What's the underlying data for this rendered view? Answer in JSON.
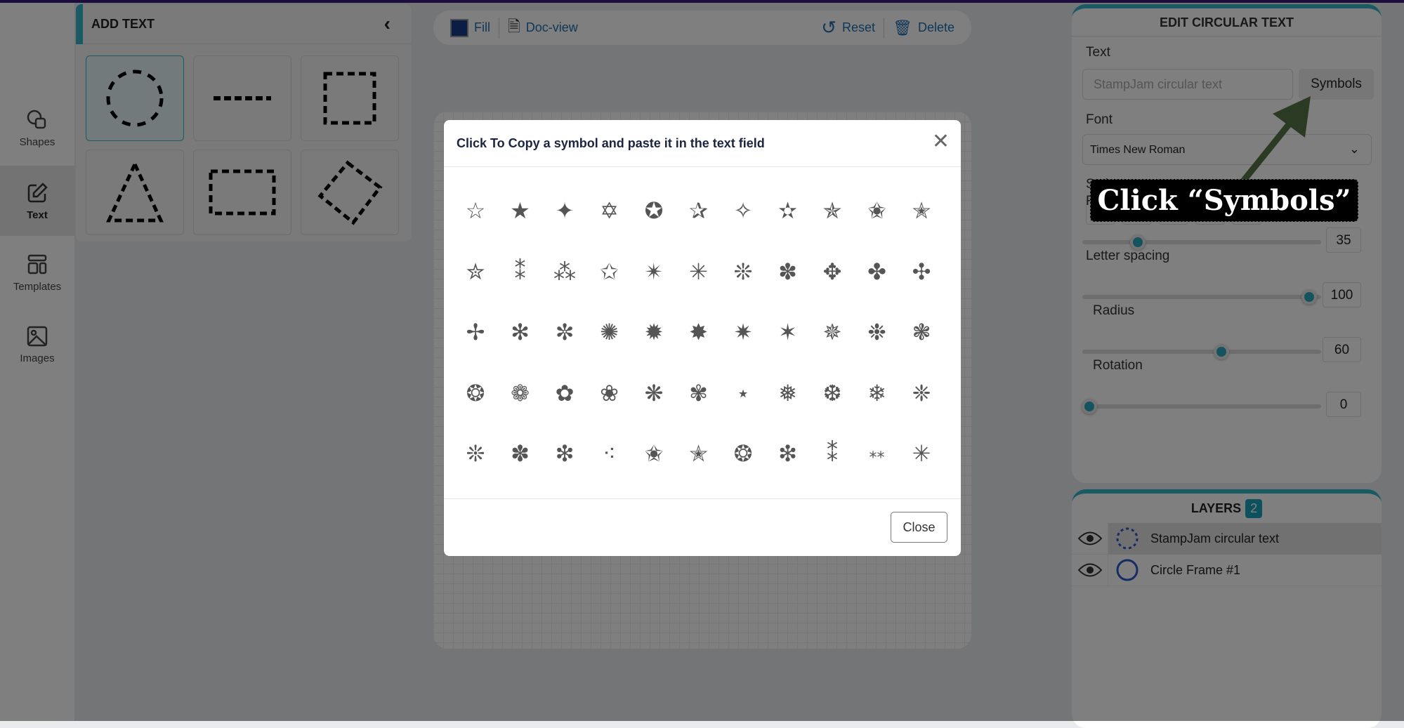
{
  "nav": {
    "items": [
      {
        "label": "Shapes",
        "icon": "shapes-icon"
      },
      {
        "label": "Text",
        "icon": "edit-icon",
        "active": true
      },
      {
        "label": "Templates",
        "icon": "templates-icon"
      },
      {
        "label": "Images",
        "icon": "image-icon"
      }
    ]
  },
  "add_panel": {
    "title": "ADD TEXT",
    "shapes": [
      "dashed-circle",
      "dashed-line",
      "dashed-square",
      "dashed-triangle",
      "dashed-rectangle",
      "dashed-diamond"
    ]
  },
  "toolbar": {
    "fill": "Fill",
    "fill_color": "#173a8a",
    "docview": "Doc-view",
    "reset": "Reset",
    "delete": "Delete"
  },
  "edit_panel": {
    "title": "EDIT CIRCULAR TEXT",
    "text_label": "Text",
    "text_placeholder": "StampJam circular text",
    "symbols": "Symbols",
    "font_label": "Font",
    "font_value": "Times New Roman",
    "style_label": "Style",
    "sliders": [
      {
        "label": "Font size",
        "value": "35",
        "level": 0.22
      },
      {
        "label": "Letter spacing",
        "value": "100",
        "level": 1.0
      },
      {
        "label": "Radius",
        "value": "60",
        "level": 0.6
      },
      {
        "label": "Rotation",
        "value": "0",
        "level": 0
      }
    ]
  },
  "layers": {
    "title": "LAYERS",
    "count": "2",
    "items": [
      {
        "name": "StampJam circular text",
        "icon": "dashed-circle-icon",
        "selected": true
      },
      {
        "name": "Circle Frame #1",
        "icon": "circle-icon"
      }
    ]
  },
  "modal": {
    "title": "Click To Copy a symbol and paste it in the text field",
    "close": "Close",
    "symbols": [
      "☆",
      "★",
      "✦",
      "✡",
      "✪",
      "✰",
      "✧",
      "✫",
      "✯",
      "✬",
      "✭",
      "✮",
      "⁑",
      "⁂",
      "✩",
      "✴",
      "✳",
      "❊",
      "✽",
      "✥",
      "✤",
      "✣",
      "✢",
      "✻",
      "✼",
      "✺",
      "✹",
      "✸",
      "✷",
      "✶",
      "✵",
      "❉",
      "❃",
      "❂",
      "❁",
      "✿",
      "❀",
      "❋",
      "✾",
      "⋆",
      "❅",
      "❆",
      "❄",
      "❈",
      "❊",
      "✽",
      "❇",
      "⁖",
      "✬",
      "✭",
      "❂",
      "❇",
      "⁑",
      "⁎⁎",
      "✳"
    ]
  },
  "annotation": {
    "text": "Click “Symbols”",
    "color": "#2b3a22"
  }
}
